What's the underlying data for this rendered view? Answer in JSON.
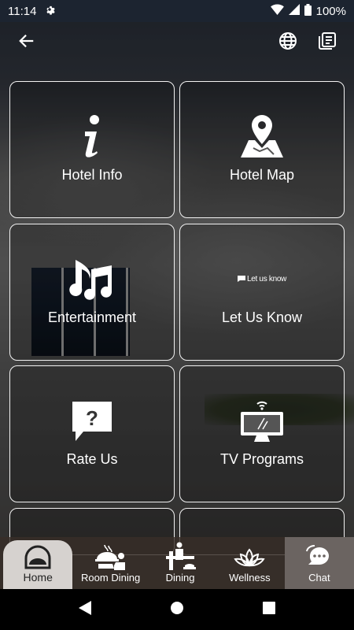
{
  "status": {
    "time": "11:14",
    "battery": "100%"
  },
  "tiles": [
    {
      "label": "Hotel Info"
    },
    {
      "label": "Hotel Map"
    },
    {
      "label": "Entertainment"
    },
    {
      "label": "Let Us Know",
      "brand_text": "Let us know"
    },
    {
      "label": "Rate Us"
    },
    {
      "label": "TV Programs"
    }
  ],
  "bottom_nav": [
    {
      "label": "Home",
      "icon": "home-dome-icon"
    },
    {
      "label": "Room Dining",
      "icon": "room-dining-icon"
    },
    {
      "label": "Dining",
      "icon": "dining-icon"
    },
    {
      "label": "Wellness",
      "icon": "lotus-icon"
    },
    {
      "label": "Chat",
      "icon": "chat-bubble-icon"
    }
  ],
  "colors": {
    "tile_border": "#f2f2f2",
    "nav_bg": "#382e28",
    "home_tab_bg": "#d6d2cf"
  }
}
